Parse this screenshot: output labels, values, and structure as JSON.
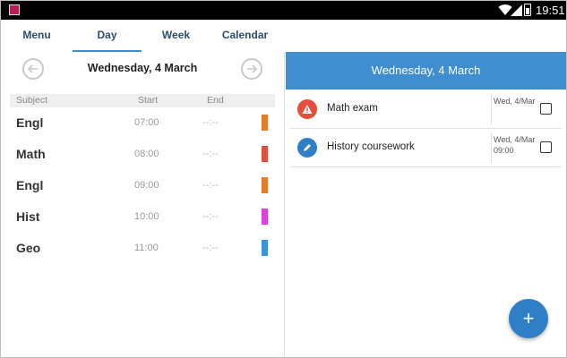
{
  "status_bar": {
    "time": "19:51"
  },
  "tabs": [
    {
      "label": "Menu",
      "active": false
    },
    {
      "label": "Day",
      "active": true
    },
    {
      "label": "Week",
      "active": false
    },
    {
      "label": "Calendar",
      "active": false
    }
  ],
  "day": {
    "date": "Wednesday, 4 March",
    "columns": {
      "subject": "Subject",
      "start": "Start",
      "end": "End"
    },
    "lessons": [
      {
        "subject": "Engl",
        "start": "07:00",
        "end": "--:--",
        "color": "#e67e22"
      },
      {
        "subject": "Math",
        "start": "08:00",
        "end": "--:--",
        "color": "#e74c3c"
      },
      {
        "subject": "Engl",
        "start": "09:00",
        "end": "--:--",
        "color": "#e67e22"
      },
      {
        "subject": "Hist",
        "start": "10:00",
        "end": "--:--",
        "color": "#e040e0"
      },
      {
        "subject": "Geo",
        "start": "11:00",
        "end": "--:--",
        "color": "#3498db"
      }
    ]
  },
  "tasks_panel": {
    "header": "Wednesday, 4 March",
    "tasks": [
      {
        "title": "Math exam",
        "date": "Wed, 4/Mar",
        "time": "",
        "icon": "warning-icon",
        "icon_color": "#e74c3c",
        "checked": false
      },
      {
        "title": "History coursework",
        "date": "Wed, 4/Mar",
        "time": "09:00",
        "icon": "pen-icon",
        "icon_color": "#2f7fc7",
        "checked": false
      }
    ]
  },
  "fab": {
    "label": "+"
  },
  "icons": {
    "prev": "arrow-left-icon",
    "next": "arrow-right-icon",
    "add": "plus-icon"
  }
}
